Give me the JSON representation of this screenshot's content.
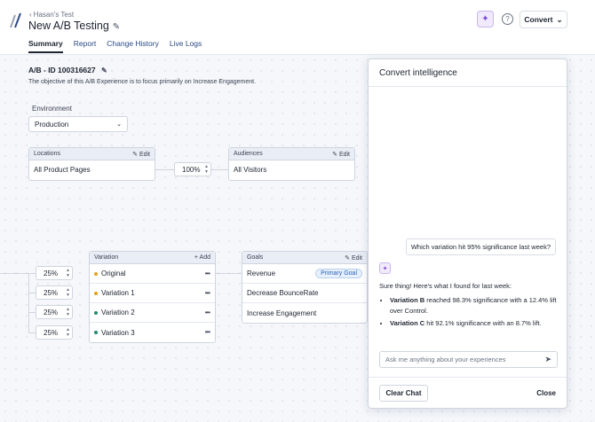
{
  "header": {
    "breadcrumb": "Hasan's Test",
    "title": "New A/B Testing",
    "tabs": [
      "Summary",
      "Report",
      "Change History",
      "Live Logs"
    ],
    "convert_label": "Convert"
  },
  "summary": {
    "id_label": "A/B - ID 100316627",
    "objective": "The objective of this A/B Experience is to focus primarily on Increase Engagement.",
    "environment_label": "Environment",
    "environment_value": "Production"
  },
  "locations": {
    "title": "Locations",
    "action": "Edit",
    "value": "All Product Pages"
  },
  "traffic_percent": "100%",
  "audiences": {
    "title": "Audiences",
    "action": "Edit",
    "value": "All Visitors"
  },
  "variation": {
    "title": "Variation",
    "action": "Add",
    "items": [
      {
        "name": "Original",
        "percent": "25%",
        "color": "#e3a21a"
      },
      {
        "name": "Variation 1",
        "percent": "25%",
        "color": "#e3a21a"
      },
      {
        "name": "Variation 2",
        "percent": "25%",
        "color": "#1f8a6e"
      },
      {
        "name": "Variation 3",
        "percent": "25%",
        "color": "#1f8a6e"
      }
    ]
  },
  "goals": {
    "title": "Goals",
    "action": "Edit",
    "items": [
      "Revenue",
      "Decrease BounceRate",
      "Increase Engagement"
    ],
    "primary_badge": "Primary Goal"
  },
  "panel": {
    "title": "Convert intelligence",
    "user_message": "Which variation hit 95% significance last week?",
    "ai_intro": "Sure thing! Here's what I found for last week:",
    "ai_items": [
      {
        "bold": "Variation B",
        "text": " reached 98.3% significance with a 12.4% lift over Control."
      },
      {
        "bold": "Variation C",
        "text": " hit 92.1% significance with an 8.7% lift."
      }
    ],
    "input_placeholder": "Ask me anything about your experiences",
    "clear_label": "Clear Chat",
    "close_label": "Close"
  }
}
